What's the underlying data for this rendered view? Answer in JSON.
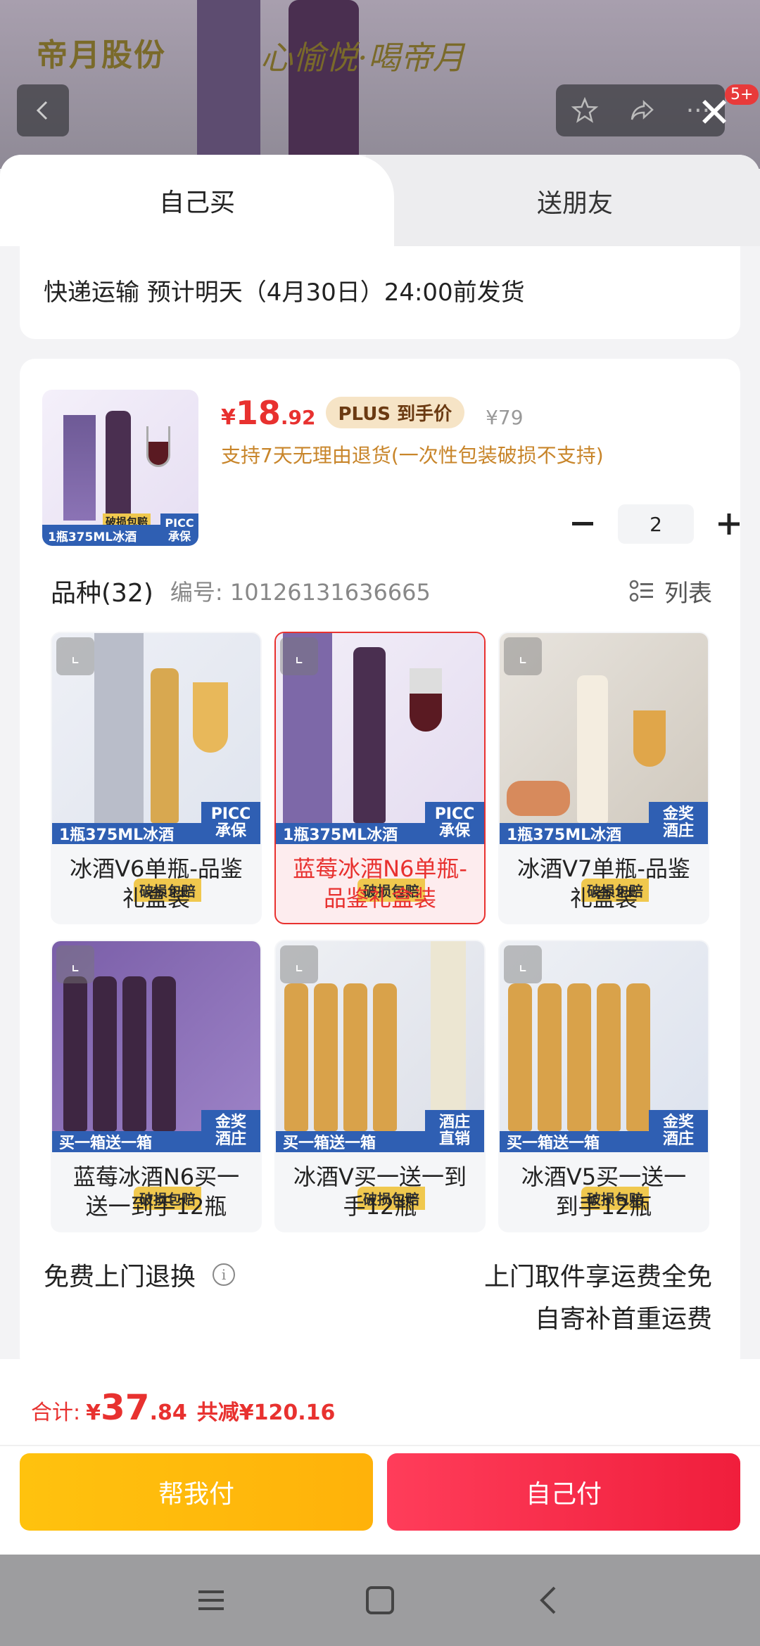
{
  "background": {
    "brand": "帝月股份",
    "slogan": "心愉悦·喝帝月",
    "cart_badge": "5+"
  },
  "tabs": {
    "self": "自己买",
    "friend": "送朋友"
  },
  "shipping": {
    "text": "快递运输 预计明天（4月30日）24:00前发货"
  },
  "product": {
    "thumb_band": "1瓶375ML冰酒",
    "thumb_damage": "破损包赔",
    "thumb_badge_line1": "PICC",
    "thumb_badge_line2": "承保",
    "price_currency": "¥",
    "price_int": "18",
    "price_dec": ".92",
    "plus_tag": "PLUS 到手价",
    "original_price": "¥79",
    "return_note": "支持7天无理由退货(一次性包装破损不支持)",
    "quantity": "2"
  },
  "variety": {
    "title": "品种(32)",
    "code": "编号: 10126131636665",
    "view_toggle": "列表"
  },
  "variants": [
    {
      "label": "冰酒V6单瓶-品鉴礼盒装",
      "band": "1瓶375ML冰酒",
      "damage": "破损包赔",
      "badge1": "PICC",
      "badge2": "承保",
      "selected": false
    },
    {
      "label": "蓝莓冰酒N6单瓶-品鉴礼盒装",
      "band": "1瓶375ML冰酒",
      "damage": "破损包赔",
      "badge1": "PICC",
      "badge2": "承保",
      "selected": true
    },
    {
      "label": "冰酒V7单瓶-品鉴礼盒装",
      "band": "1瓶375ML冰酒",
      "damage": "破损包赔",
      "badge1": "金奖",
      "badge2": "酒庄",
      "selected": false
    },
    {
      "label": "蓝莓冰酒N6买一送一到手12瓶",
      "band": "买一箱送一箱",
      "damage": "破损包赔",
      "badge1": "金奖",
      "badge2": "酒庄",
      "selected": false
    },
    {
      "label": "冰酒V买一送一到手12瓶",
      "band": "买一箱送一箱",
      "damage": "破损包赔",
      "badge1": "酒庄",
      "badge2": "直销",
      "selected": false
    },
    {
      "label": "冰酒V5买一送一到手12瓶",
      "band": "买一箱送一箱",
      "damage": "破损包赔",
      "badge1": "金奖",
      "badge2": "酒庄",
      "selected": false
    }
  ],
  "free_return": {
    "title": "免费上门退换",
    "line1": "上门取件享运费全免",
    "line2": "自寄补首重运费"
  },
  "total": {
    "label": "合计:",
    "currency": "¥",
    "int": "37",
    "dec": ".84",
    "saved": "共减¥120.16"
  },
  "buttons": {
    "help_pay": "帮我付",
    "self_pay": "自己付"
  },
  "colors": {
    "accent_red": "#e8312f",
    "gold": "#ffb20a",
    "band_blue": "#2f5fb3"
  }
}
